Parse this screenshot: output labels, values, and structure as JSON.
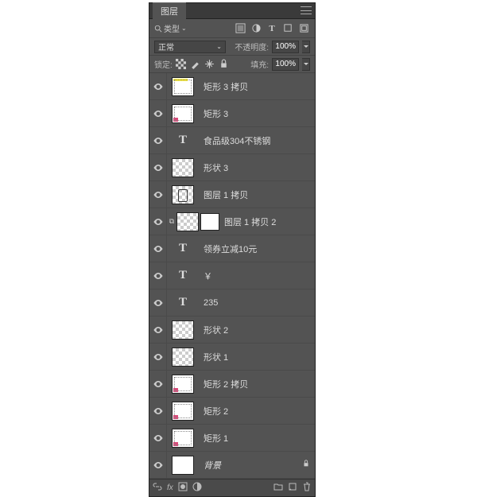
{
  "panel": {
    "title": "图层"
  },
  "filter": {
    "search_label": "类型",
    "icons": [
      "image",
      "fx",
      "text",
      "shape",
      "smart"
    ]
  },
  "blend": {
    "mode": "正常",
    "opacity_label": "不透明度:",
    "opacity_value": "100%"
  },
  "lock": {
    "label": "锁定:",
    "fill_label": "填充:",
    "fill_value": "100%"
  },
  "layers": [
    {
      "type": "shape",
      "name": "矩形 3 拷贝",
      "thumb": "yellow"
    },
    {
      "type": "shape",
      "name": "矩形 3",
      "thumb": "pink"
    },
    {
      "type": "text",
      "name": "食品级304不锈钢"
    },
    {
      "type": "shape",
      "name": "形状 3",
      "thumb": "chk"
    },
    {
      "type": "shape",
      "name": "图层 1 拷贝",
      "thumb": "kettle"
    },
    {
      "type": "masked",
      "name": "图层 1 拷贝 2",
      "thumb": "chk"
    },
    {
      "type": "text",
      "name": "领券立减10元"
    },
    {
      "type": "text",
      "name": "￥"
    },
    {
      "type": "text",
      "name": "235"
    },
    {
      "type": "shape",
      "name": "形状 2",
      "thumb": "chk"
    },
    {
      "type": "shape",
      "name": "形状 1",
      "thumb": "chk"
    },
    {
      "type": "shape",
      "name": "矩形 2 拷贝",
      "thumb": "pink"
    },
    {
      "type": "shape",
      "name": "矩形 2",
      "thumb": "pink"
    },
    {
      "type": "shape",
      "name": "矩形 1",
      "thumb": "pink"
    },
    {
      "type": "bg",
      "name": "背景",
      "thumb": "white"
    }
  ],
  "palette": {
    "panel": "#535353",
    "text": "#ddd",
    "yellow": "#f5e837",
    "pink": "#d94a7a"
  }
}
